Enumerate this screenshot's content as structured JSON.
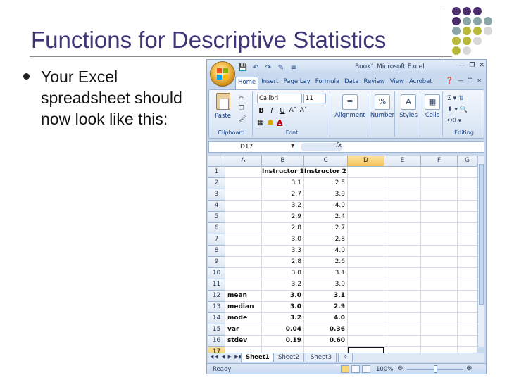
{
  "slide": {
    "title": "Functions for Descriptive Statistics",
    "bullet": "Your Excel spreadsheet should now look like this:",
    "dot_colors": [
      "#4a2d6b",
      "#8aa5a8",
      "#b8b83a",
      "#d8d8d8"
    ]
  },
  "excel": {
    "window_title": "Book1   Microsoft Excel",
    "tabs": [
      "Home",
      "Insert",
      "Page Lay",
      "Formula",
      "Data",
      "Review",
      "View",
      "Acrobat"
    ],
    "ribbon": {
      "paste": "Paste",
      "clipboard": "Clipboard",
      "font_name": "Calibri",
      "font_size": "11",
      "font": "Font",
      "alignment": "Alignment",
      "number": "Number",
      "styles": "Styles",
      "cells": "Cells",
      "editing": "Editing"
    },
    "name_box": "D17",
    "formula_icon": "fx",
    "columns": [
      "A",
      "B",
      "C",
      "D",
      "E",
      "F",
      "G"
    ],
    "rows": [
      {
        "n": "1",
        "a": "",
        "b": "Instructor 1",
        "c": "Instructor 2",
        "bold": true,
        "header": true
      },
      {
        "n": "2",
        "a": "",
        "b": "3.1",
        "c": "2.5"
      },
      {
        "n": "3",
        "a": "",
        "b": "2.7",
        "c": "3.9"
      },
      {
        "n": "4",
        "a": "",
        "b": "3.2",
        "c": "4.0"
      },
      {
        "n": "5",
        "a": "",
        "b": "2.9",
        "c": "2.4"
      },
      {
        "n": "6",
        "a": "",
        "b": "2.8",
        "c": "2.7"
      },
      {
        "n": "7",
        "a": "",
        "b": "3.0",
        "c": "2.8"
      },
      {
        "n": "8",
        "a": "",
        "b": "3.3",
        "c": "4.0"
      },
      {
        "n": "9",
        "a": "",
        "b": "2.8",
        "c": "2.6"
      },
      {
        "n": "10",
        "a": "",
        "b": "3.0",
        "c": "3.1"
      },
      {
        "n": "11",
        "a": "",
        "b": "3.2",
        "c": "3.0"
      },
      {
        "n": "12",
        "a": "mean",
        "b": "3.0",
        "c": "3.1",
        "bold": true
      },
      {
        "n": "13",
        "a": "median",
        "b": "3.0",
        "c": "2.9",
        "bold": true
      },
      {
        "n": "14",
        "a": "mode",
        "b": "3.2",
        "c": "4.0",
        "bold": true
      },
      {
        "n": "15",
        "a": "var",
        "b": "0.04",
        "c": "0.36",
        "bold": true
      },
      {
        "n": "16",
        "a": "stdev",
        "b": "0.19",
        "c": "0.60",
        "bold": true
      },
      {
        "n": "17",
        "a": "",
        "b": "",
        "c": ""
      }
    ],
    "sheets": [
      "Sheet1",
      "Sheet2",
      "Sheet3"
    ],
    "status": "Ready",
    "zoom": "100%"
  }
}
